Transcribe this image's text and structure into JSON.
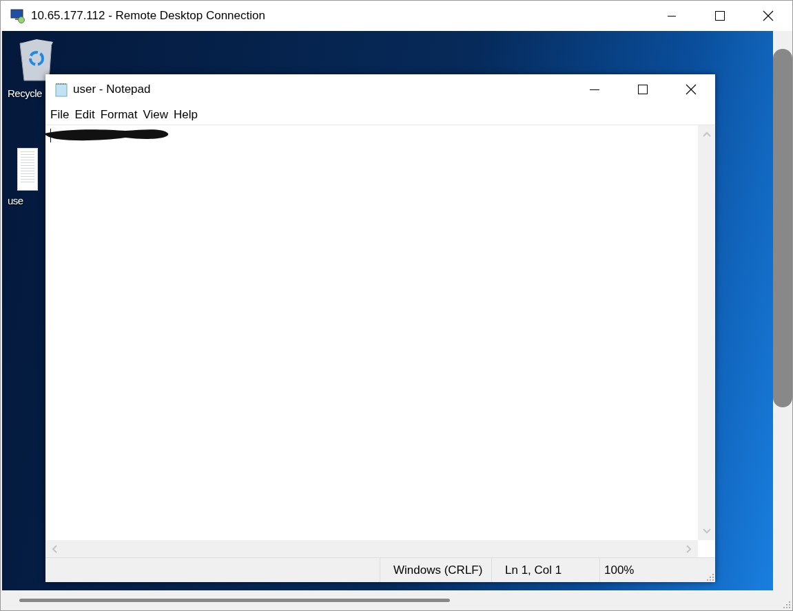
{
  "remote_window": {
    "title": "10.65.177.112 - Remote Desktop Connection"
  },
  "desktop_icons": [
    {
      "kind": "recycle-bin",
      "label": "Recycle"
    },
    {
      "kind": "text-file",
      "label": "use"
    }
  ],
  "notepad": {
    "title": "user - Notepad",
    "menu": [
      "File",
      "Edit",
      "Format",
      "View",
      "Help"
    ],
    "status_bar": [
      "Windows (CRLF)",
      "Ln 1, Col 1",
      "100%"
    ]
  }
}
